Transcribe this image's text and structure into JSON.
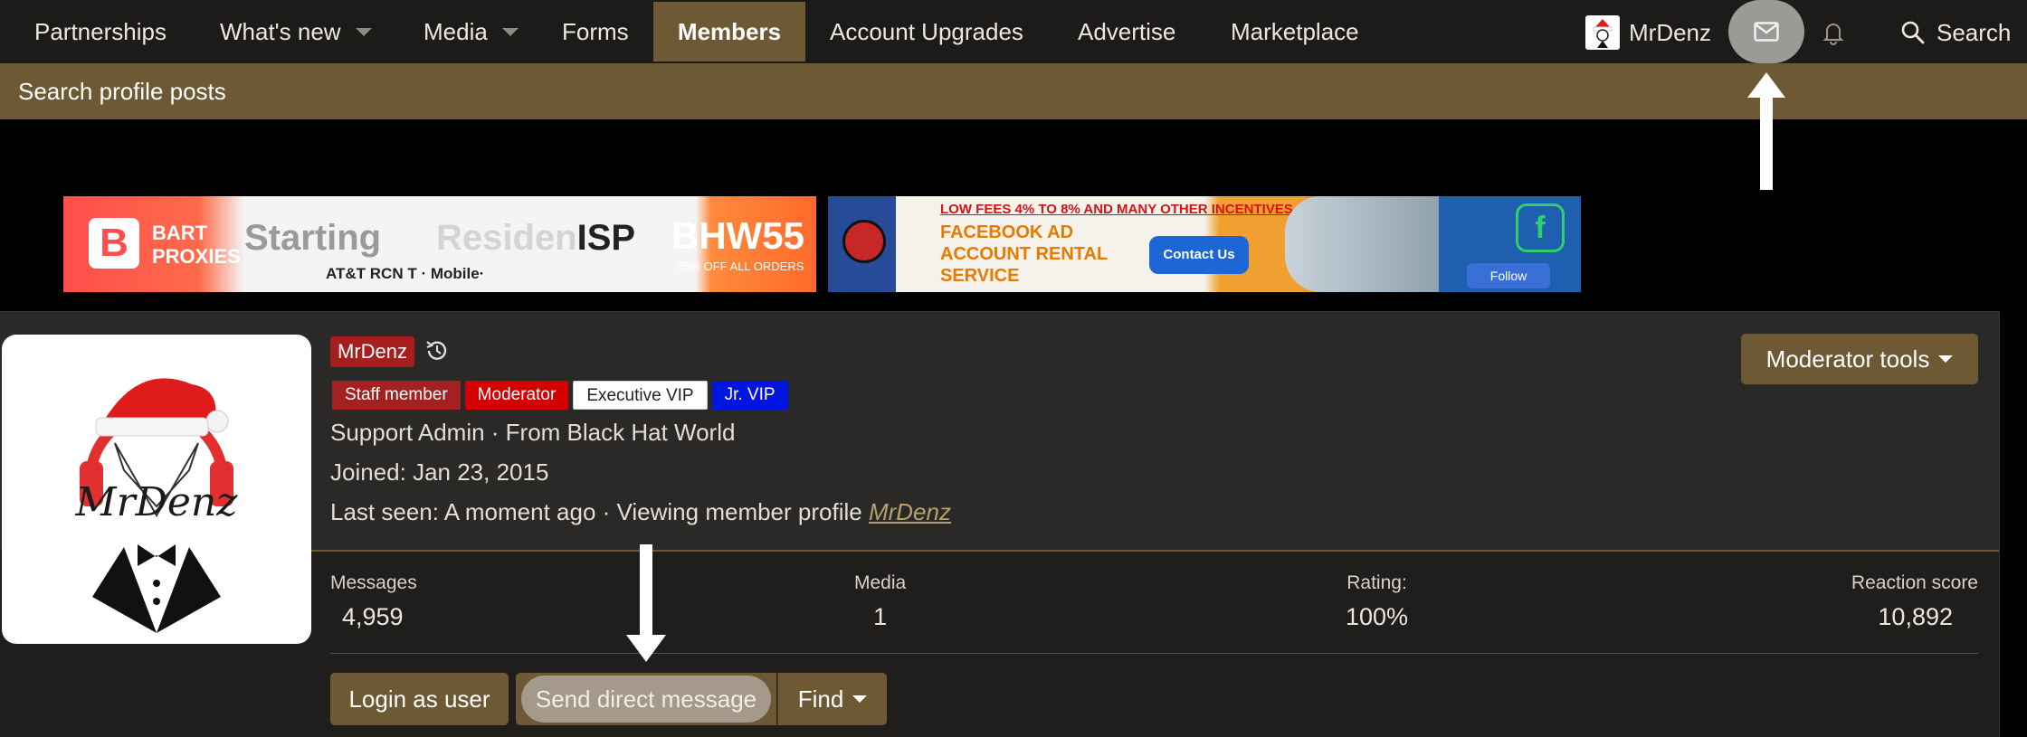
{
  "nav": {
    "items": [
      {
        "label": "Partnerships"
      },
      {
        "label": "What's new"
      },
      {
        "label": "Media"
      },
      {
        "label": "Forms"
      },
      {
        "label": "Members"
      },
      {
        "label": "Account Upgrades"
      },
      {
        "label": "Advertise"
      },
      {
        "label": "Marketplace"
      }
    ],
    "active": "Members",
    "user_name": "MrDenz",
    "search_label": "Search",
    "accent_color": "#6d5a34"
  },
  "subnav": {
    "label": "Search profile posts"
  },
  "ads": {
    "bart": {
      "brand_line1": "BART",
      "brand_line2": "PROXIES",
      "starting": "Starting",
      "residen": "Residen",
      "isp": "ISP",
      "carriers": "AT&T   RCN   T · Mobile·",
      "code": "BHW55",
      "off": "55% OFF ALL ORDERS"
    },
    "fb": {
      "top_line": "LOW FEES 4% TO 8% AND MANY OTHER INCENTIVES",
      "main_line1": "FACEBOOK AD",
      "main_line2": "ACCOUNT RENTAL",
      "main_line3": "SERVICE",
      "contact": "Contact Us",
      "follow": "Follow"
    }
  },
  "profile": {
    "username": "MrDenz",
    "avatar_text": "MrDenz",
    "user_banners": [
      {
        "label": "Staff member"
      },
      {
        "label": "Moderator"
      },
      {
        "label": "Executive VIP"
      },
      {
        "label": "Jr. VIP"
      }
    ],
    "title_line": "Support Admin · From Black Hat World",
    "joined": "Joined: Jan 23, 2015",
    "last_seen_prefix": "Last seen: A moment ago · Viewing member profile ",
    "last_seen_link": "MrDenz",
    "moderator_tools": "Moderator tools",
    "stats": [
      {
        "label": "Messages",
        "value": "4,959"
      },
      {
        "label": "Media",
        "value": "1"
      },
      {
        "label": "Rating:",
        "value": "100%"
      },
      {
        "label": "Reaction score",
        "value": "10,892"
      }
    ],
    "actions": {
      "login_as_user": "Login as user",
      "send_dm": "Send direct message",
      "find": "Find"
    }
  }
}
